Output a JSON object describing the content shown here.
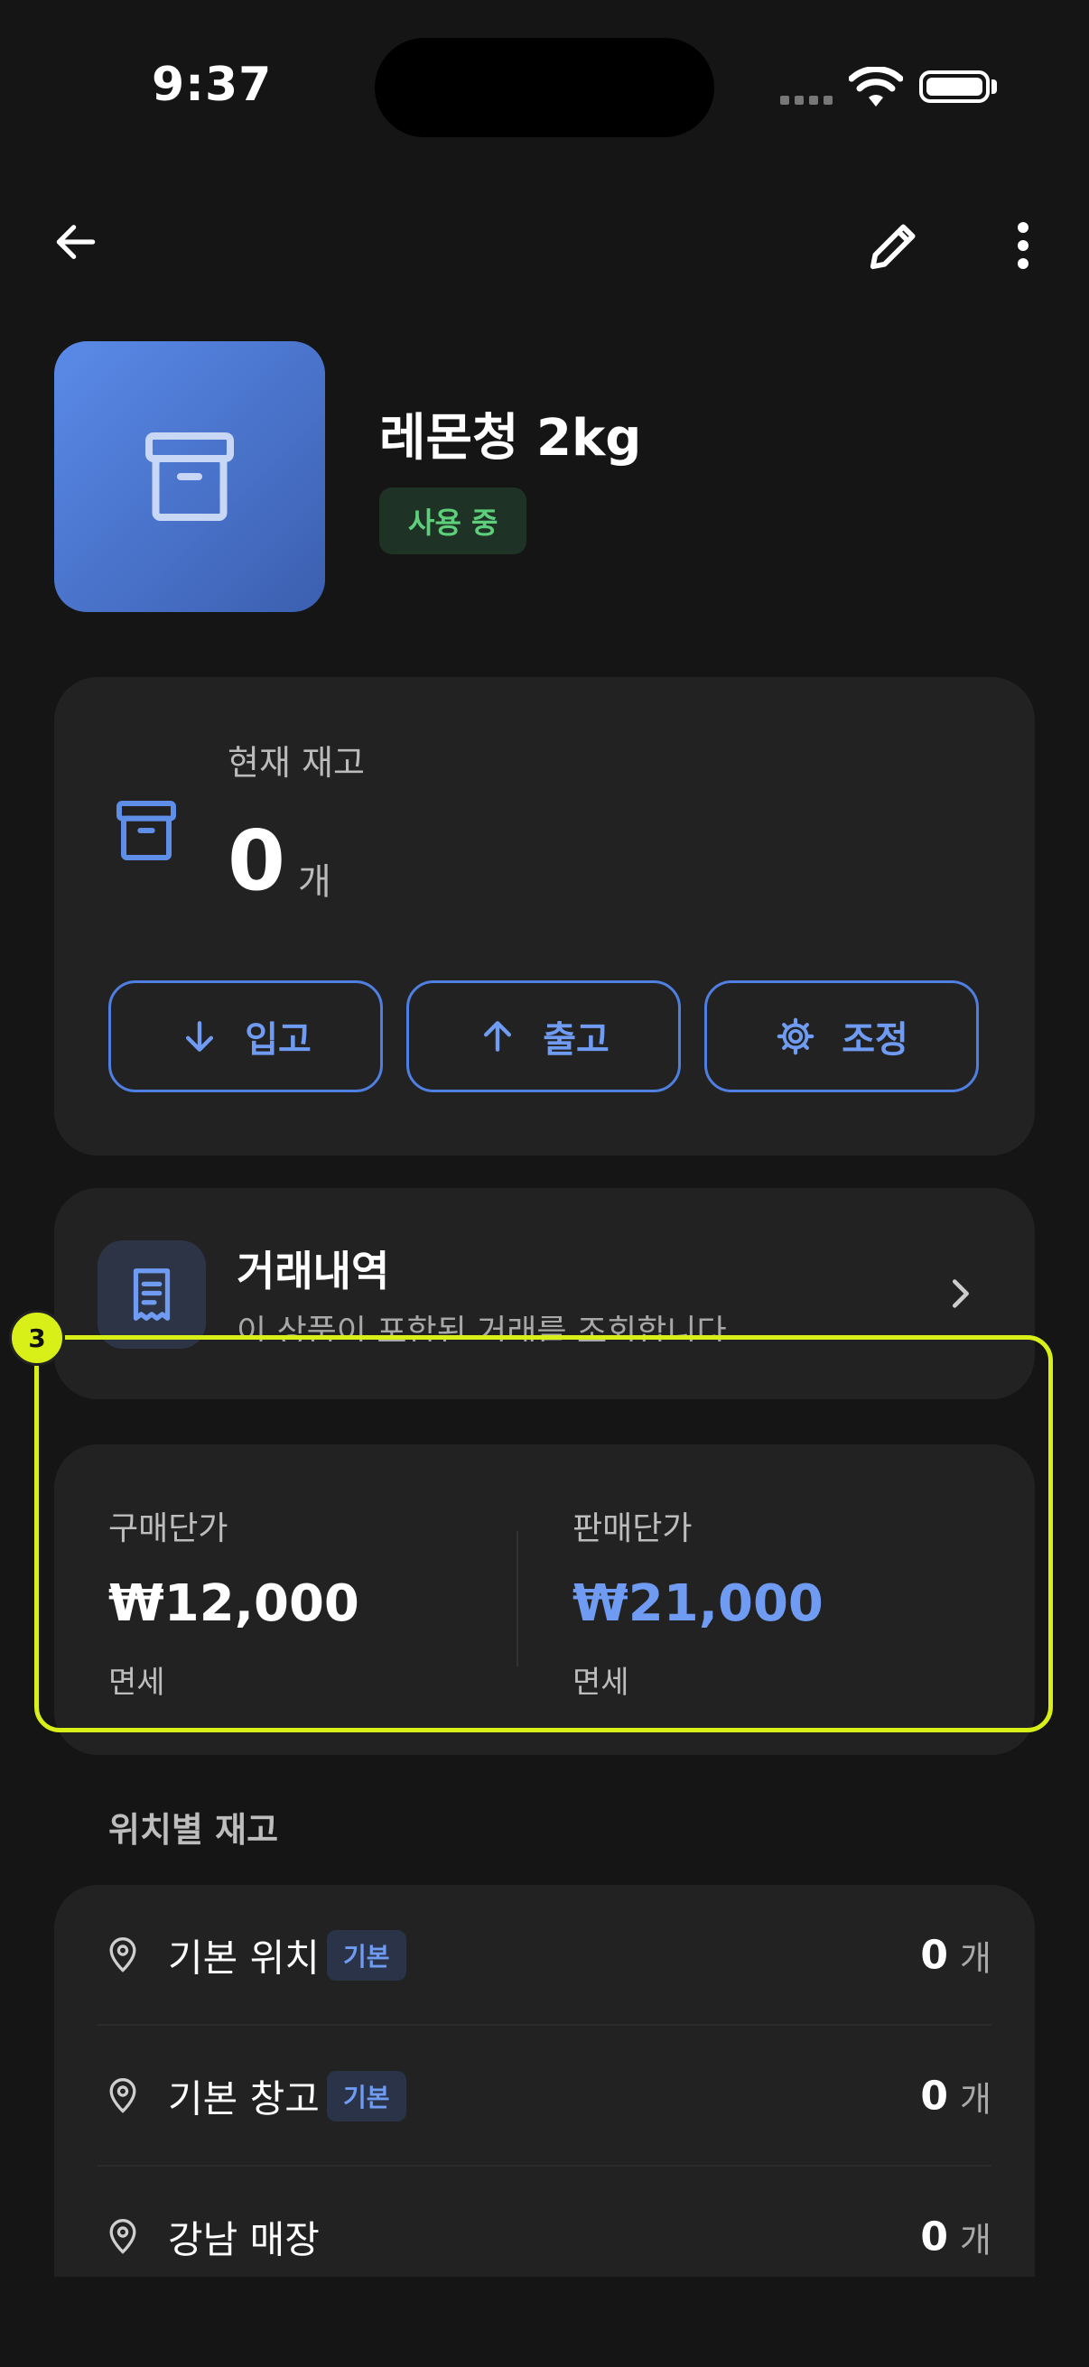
{
  "status_bar": {
    "time": "9:37"
  },
  "product": {
    "name": "레몬청 2kg",
    "status_badge": "사용 중"
  },
  "stock": {
    "label": "현재 재고",
    "quantity": "0",
    "unit": "개"
  },
  "actions": [
    {
      "label": "입고",
      "icon": "arrow-down-icon"
    },
    {
      "label": "출고",
      "icon": "arrow-up-icon"
    },
    {
      "label": "조정",
      "icon": "gear-icon"
    }
  ],
  "transactions": {
    "title": "거래내역",
    "subtitle": "이 상품이 포함된 거래를 조회합니다"
  },
  "prices": {
    "purchase": {
      "label": "구매단가",
      "value": "₩12,000",
      "tax": "면세"
    },
    "sale": {
      "label": "판매단가",
      "value": "₩21,000",
      "tax": "면세"
    }
  },
  "locations": {
    "title": "위치별 재고",
    "items": [
      {
        "name": "기본 위치",
        "badge": "기본",
        "qty": "0",
        "unit": "개"
      },
      {
        "name": "기본 창고",
        "badge": "기본",
        "qty": "0",
        "unit": "개"
      },
      {
        "name": "강남 매장",
        "badge": "",
        "qty": "0",
        "unit": "개"
      }
    ]
  },
  "highlight": {
    "number": "3"
  },
  "colors": {
    "accent": "#6f9cf2",
    "success": "#5dcf7b",
    "highlight": "#d8f018",
    "card": "#222222",
    "background": "#151515"
  }
}
